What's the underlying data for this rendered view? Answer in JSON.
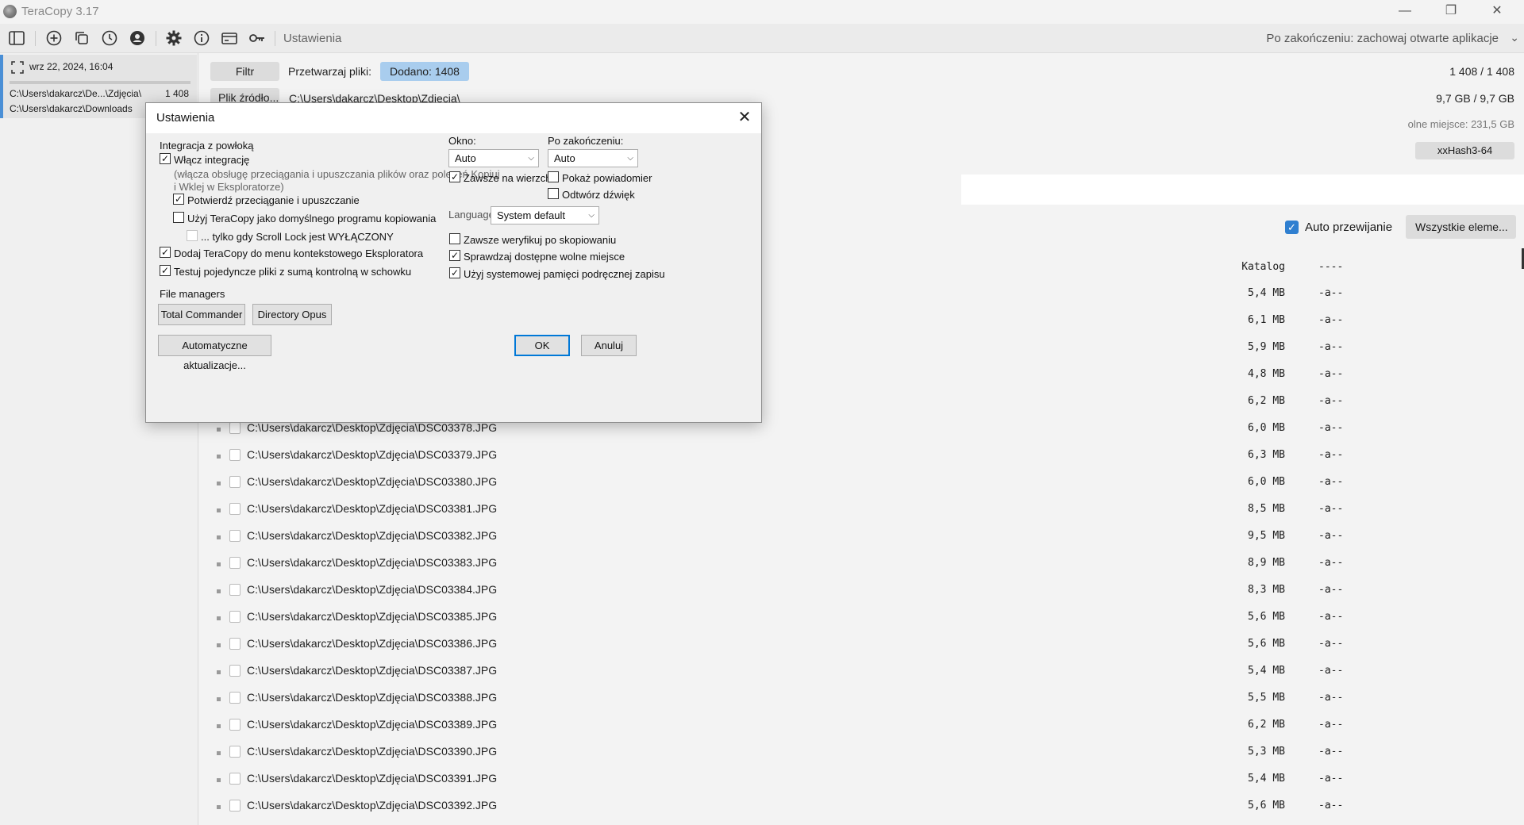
{
  "window": {
    "title": "TeraCopy 3.17",
    "minimize": "—",
    "maximize": "❐",
    "close": "✕"
  },
  "toolbar": {
    "settings_label": "Ustawienia",
    "on_finish_label": "Po zakończeniu: zachowaj otwarte aplikacje",
    "icons": [
      "sidebar-icon",
      "add-icon",
      "copy-icon",
      "history-icon",
      "account-icon",
      "gear-icon",
      "info-icon",
      "card-icon",
      "key-icon"
    ]
  },
  "job": {
    "date": "wrz 22, 2024, 16:04",
    "source": "C:\\Users\\dakarcz\\De...\\Zdjęcia\\",
    "count": "1 408",
    "destination": "C:\\Users\\dakarcz\\Downloads"
  },
  "main": {
    "filter_button": "Filtr",
    "process_label": "Przetwarzaj pliki:",
    "added_badge": "Dodano: 1408",
    "source_button": "Plik źródło...",
    "source_path": "C:\\Users\\dakarcz\\Desktop\\Zdjęcia\\",
    "files_count": "1 408 / 1 408",
    "size_total": "9,7 GB / 9,7 GB",
    "free_space": "olne miejsce: 231,5 GB",
    "hash": "xxHash3-64",
    "auto_scroll": "Auto przewijanie",
    "all_items": "Wszystkie eleme...",
    "catalog_header": "Katalog",
    "catalog_attr": "----"
  },
  "files": [
    {
      "path": "",
      "size": "5,4 MB",
      "attr": "-a--"
    },
    {
      "path": "",
      "size": "6,1 MB",
      "attr": "-a--"
    },
    {
      "path": "",
      "size": "5,9 MB",
      "attr": "-a--"
    },
    {
      "path": "",
      "size": "4,8 MB",
      "attr": "-a--"
    },
    {
      "path": "",
      "size": "6,2 MB",
      "attr": "-a--"
    },
    {
      "path": "C:\\Users\\dakarcz\\Desktop\\Zdjęcia\\DSC03378.JPG",
      "size": "6,0 MB",
      "attr": "-a--"
    },
    {
      "path": "C:\\Users\\dakarcz\\Desktop\\Zdjęcia\\DSC03379.JPG",
      "size": "6,3 MB",
      "attr": "-a--"
    },
    {
      "path": "C:\\Users\\dakarcz\\Desktop\\Zdjęcia\\DSC03380.JPG",
      "size": "6,0 MB",
      "attr": "-a--"
    },
    {
      "path": "C:\\Users\\dakarcz\\Desktop\\Zdjęcia\\DSC03381.JPG",
      "size": "8,5 MB",
      "attr": "-a--"
    },
    {
      "path": "C:\\Users\\dakarcz\\Desktop\\Zdjęcia\\DSC03382.JPG",
      "size": "9,5 MB",
      "attr": "-a--"
    },
    {
      "path": "C:\\Users\\dakarcz\\Desktop\\Zdjęcia\\DSC03383.JPG",
      "size": "8,9 MB",
      "attr": "-a--"
    },
    {
      "path": "C:\\Users\\dakarcz\\Desktop\\Zdjęcia\\DSC03384.JPG",
      "size": "8,3 MB",
      "attr": "-a--"
    },
    {
      "path": "C:\\Users\\dakarcz\\Desktop\\Zdjęcia\\DSC03385.JPG",
      "size": "5,6 MB",
      "attr": "-a--"
    },
    {
      "path": "C:\\Users\\dakarcz\\Desktop\\Zdjęcia\\DSC03386.JPG",
      "size": "5,6 MB",
      "attr": "-a--"
    },
    {
      "path": "C:\\Users\\dakarcz\\Desktop\\Zdjęcia\\DSC03387.JPG",
      "size": "5,4 MB",
      "attr": "-a--"
    },
    {
      "path": "C:\\Users\\dakarcz\\Desktop\\Zdjęcia\\DSC03388.JPG",
      "size": "5,5 MB",
      "attr": "-a--"
    },
    {
      "path": "C:\\Users\\dakarcz\\Desktop\\Zdjęcia\\DSC03389.JPG",
      "size": "6,2 MB",
      "attr": "-a--"
    },
    {
      "path": "C:\\Users\\dakarcz\\Desktop\\Zdjęcia\\DSC03390.JPG",
      "size": "5,3 MB",
      "attr": "-a--"
    },
    {
      "path": "C:\\Users\\dakarcz\\Desktop\\Zdjęcia\\DSC03391.JPG",
      "size": "5,4 MB",
      "attr": "-a--"
    },
    {
      "path": "C:\\Users\\dakarcz\\Desktop\\Zdjęcia\\DSC03392.JPG",
      "size": "5,6 MB",
      "attr": "-a--"
    }
  ],
  "dialog": {
    "title": "Ustawienia",
    "shell_section": "Integracja z powłoką",
    "enable_integration": "Włącz integrację",
    "enable_integration_checked": true,
    "integration_note_1": "(włącza obsługę przeciągania i upuszczania plików oraz poleceń Kopiuj",
    "integration_note_2": "i Wklej w Eksploratorze)",
    "confirm_dragdrop": "Potwierdź przeciąganie i upuszczanie",
    "confirm_dragdrop_checked": true,
    "default_copier": "Użyj TeraCopy jako domyślnego programu kopiowania",
    "default_copier_checked": false,
    "scroll_lock_only": "... tylko gdy Scroll Lock jest WYŁĄCZONY",
    "scroll_lock_checked": false,
    "context_menu": "Dodaj TeraCopy do menu kontekstowego Eksploratora",
    "context_menu_checked": true,
    "test_checksum": "Testuj pojedyncze pliki z sumą kontrolną w schowku",
    "test_checksum_checked": true,
    "file_managers": "File managers",
    "total_commander": "Total Commander",
    "directory_opus": "Directory Opus",
    "auto_updates": "Automatyczne aktualizacje...",
    "window_label": "Okno:",
    "window_value": "Auto",
    "after_label": "Po zakończeniu:",
    "after_value": "Auto",
    "always_on_top": "Zawsze na wierzch",
    "always_on_top_checked": true,
    "show_notification": "Pokaż powiadomier",
    "show_notification_checked": false,
    "play_sound": "Odtwórz dźwięk",
    "play_sound_checked": false,
    "language_label": "Language:",
    "language_value": "System default",
    "always_verify": "Zawsze weryfikuj po skopiowaniu",
    "always_verify_checked": false,
    "check_free_space": "Sprawdzaj dostępne wolne miejsce",
    "check_free_space_checked": true,
    "system_cache": "Użyj systemowej pamięci podręcznej zapisu",
    "system_cache_checked": true,
    "ok": "OK",
    "cancel": "Anuluj"
  }
}
